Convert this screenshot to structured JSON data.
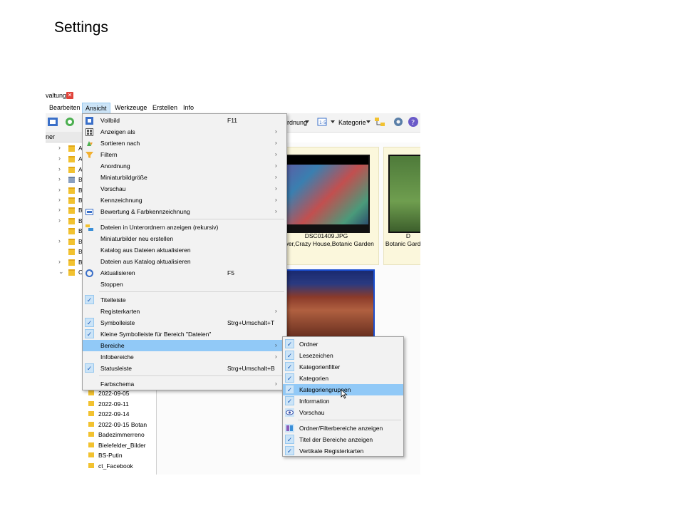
{
  "slide": {
    "title": "Settings"
  },
  "window": {
    "title_fragment": "valtung",
    "close_glyph": "✕"
  },
  "menubar": {
    "items": [
      "Bearbeiten",
      "Ansicht",
      "Werkzeuge",
      "Erstellen",
      "Info"
    ]
  },
  "toolbar": {
    "anordnung_label": "ordnung",
    "kategorie_label": "Kategorie"
  },
  "panel": {
    "header": "ner"
  },
  "tree": {
    "rows": [
      {
        "arrow": "›",
        "label": "A"
      },
      {
        "arrow": "›",
        "label": "A"
      },
      {
        "arrow": "›",
        "label": "A"
      },
      {
        "arrow": "›",
        "label": "B"
      },
      {
        "arrow": "›",
        "label": "B"
      },
      {
        "arrow": "›",
        "label": "B"
      },
      {
        "arrow": "›",
        "label": "B"
      },
      {
        "arrow": "›",
        "label": "B"
      },
      {
        "arrow": "",
        "label": "B"
      },
      {
        "arrow": "›",
        "label": "B"
      },
      {
        "arrow": "",
        "label": "B"
      },
      {
        "arrow": "›",
        "label": "B"
      },
      {
        "arrow": "⌄",
        "label": "C"
      }
    ],
    "subrows": [
      "2022-09-05",
      "2022-09-11",
      "2022-09-14",
      "2022-09-15 Botan",
      "Badezimmerreno",
      "Bielefelder_Bilder",
      "BS-Putin",
      "ct_Facebook"
    ]
  },
  "thumbs": {
    "cap1_line1": "DSC01409.JPG",
    "cap1_line2": "nover,Crazy House,Botanic Garden",
    "cap2_line1": "D",
    "cap2_line2": "Botanic Garde"
  },
  "menu_ansicht": {
    "items": [
      {
        "label": "Vollbild",
        "shortcut": "F11",
        "sub": "",
        "icon": "fullscreen-icon"
      },
      {
        "label": "Anzeigen als",
        "shortcut": "",
        "sub": "›",
        "icon": "grid-icon"
      },
      {
        "label": "Sortieren nach",
        "shortcut": "",
        "sub": "›",
        "icon": "sort-icon"
      },
      {
        "label": "Filtern",
        "shortcut": "",
        "sub": "›",
        "icon": "filter-icon"
      },
      {
        "label": "Anordnung",
        "shortcut": "",
        "sub": "›",
        "icon": ""
      },
      {
        "label": "Miniaturbildgröße",
        "shortcut": "",
        "sub": "›",
        "icon": ""
      },
      {
        "label": "Vorschau",
        "shortcut": "",
        "sub": "›",
        "icon": ""
      },
      {
        "label": "Kennzeichnung",
        "shortcut": "",
        "sub": "›",
        "icon": ""
      },
      {
        "label": "Bewertung & Farbkennzeichnung",
        "shortcut": "",
        "sub": "›",
        "icon": "rating-icon"
      },
      {
        "label": "Dateien in Unterordnern anzeigen (rekursiv)",
        "shortcut": "",
        "sub": "",
        "icon": "subfolders-icon"
      },
      {
        "label": "Miniaturbilder neu erstellen",
        "shortcut": "",
        "sub": "",
        "icon": ""
      },
      {
        "label": "Katalog aus Dateien aktualisieren",
        "shortcut": "",
        "sub": "",
        "icon": ""
      },
      {
        "label": "Dateien aus Katalog aktualisieren",
        "shortcut": "",
        "sub": "",
        "icon": ""
      },
      {
        "label": "Aktualisieren",
        "shortcut": "F5",
        "sub": "",
        "icon": "refresh-icon"
      },
      {
        "label": "Stoppen",
        "shortcut": "",
        "sub": "",
        "icon": ""
      },
      {
        "label": "Titelleiste",
        "shortcut": "",
        "sub": "",
        "icon": "check-icon"
      },
      {
        "label": "Registerkarten",
        "shortcut": "",
        "sub": "›",
        "icon": ""
      },
      {
        "label": "Symbolleiste",
        "shortcut": "Strg+Umschalt+T",
        "sub": "",
        "icon": "check-icon"
      },
      {
        "label": "Kleine Symbolleiste für Bereich \"Dateien\"",
        "shortcut": "",
        "sub": "",
        "icon": "check-icon"
      },
      {
        "label": "Bereiche",
        "shortcut": "",
        "sub": "›",
        "icon": ""
      },
      {
        "label": "Infobereiche",
        "shortcut": "",
        "sub": "›",
        "icon": ""
      },
      {
        "label": "Statusleiste",
        "shortcut": "Strg+Umschalt+B",
        "sub": "",
        "icon": "check-icon"
      },
      {
        "label": "Farbschema",
        "shortcut": "",
        "sub": "›",
        "icon": ""
      }
    ],
    "check_glyph": "✓"
  },
  "menu_bereiche": {
    "items": [
      "Ordner",
      "Lesezeichen",
      "Kategorienfilter",
      "Kategorien",
      "Kategoriengruppen",
      "Information",
      "Vorschau",
      "Ordner/Filterbereiche anzeigen",
      "Titel der Bereiche anzeigen",
      "Vertikale Registerkarten"
    ]
  }
}
